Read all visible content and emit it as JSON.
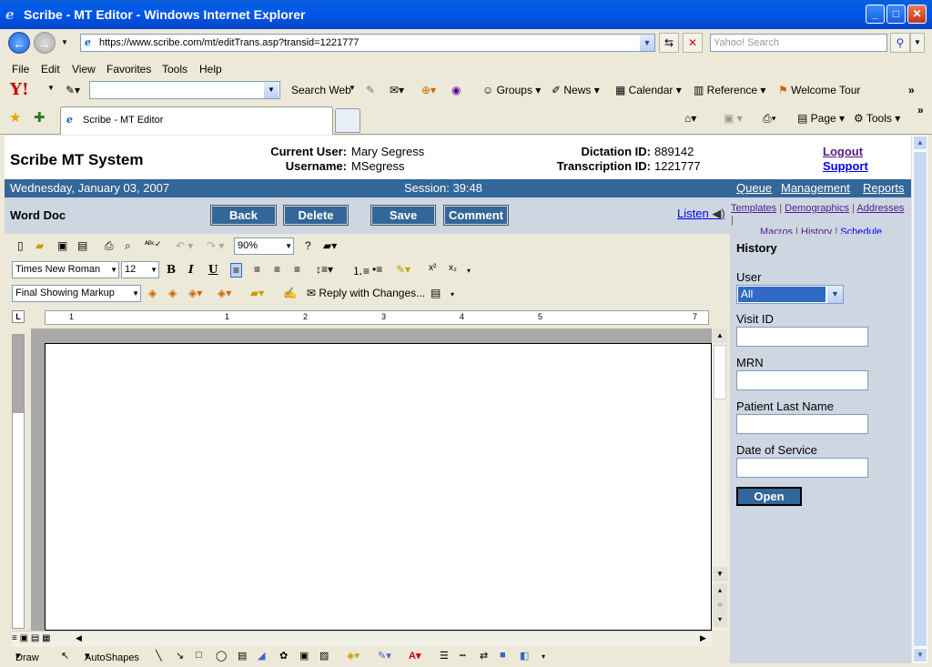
{
  "window": {
    "title": "Scribe - MT Editor - Windows Internet Explorer"
  },
  "browser": {
    "url": "https://www.scribe.com/mt/editTrans.asp?transid=1221777",
    "search_placeholder": "Yahoo! Search",
    "menu": [
      "File",
      "Edit",
      "View",
      "Favorites",
      "Tools",
      "Help"
    ],
    "yahoo_toolbar": [
      "Search Web",
      "Groups",
      "News",
      "Calendar",
      "Reference",
      "Welcome Tour"
    ],
    "tab_title": "Scribe - MT Editor",
    "page_label": "Page",
    "tools_label": "Tools"
  },
  "app": {
    "system_name": "Scribe MT System",
    "current_user_label": "Current User:",
    "current_user": "Mary Segress",
    "username_label": "Username:",
    "username": "MSegress",
    "dictation_label": "Dictation ID:",
    "dictation_id": "889142",
    "transcription_label": "Transcription ID:",
    "transcription_id": "1221777",
    "logout": "Logout",
    "support": "Support",
    "date": "Wednesday, January 03, 2007",
    "session": "Session: 39:48",
    "nav": [
      "Queue",
      "Management",
      "Reports"
    ],
    "section_label": "Word Doc",
    "buttons": {
      "back": "Back",
      "delete": "Delete",
      "save": "Save",
      "comment": "Comment"
    },
    "listen": "Listen",
    "links": [
      "Templates",
      "Demographics",
      "Addresses",
      "Macros",
      "History",
      "Schedule"
    ]
  },
  "history": {
    "title": "History",
    "user_label": "User",
    "user_value": "All",
    "visit_label": "Visit ID",
    "mrn_label": "MRN",
    "lastname_label": "Patient Last Name",
    "dos_label": "Date of Service",
    "open_button": "Open"
  },
  "word": {
    "zoom": "90%",
    "font": "Times New Roman",
    "size": "12",
    "markup": "Final Showing Markup",
    "reply": "Reply with Changes...",
    "ruler": [
      "1",
      "1",
      "2",
      "3",
      "4",
      "5",
      "7"
    ],
    "draw": "Draw",
    "autoshapes": "AutoShapes"
  }
}
